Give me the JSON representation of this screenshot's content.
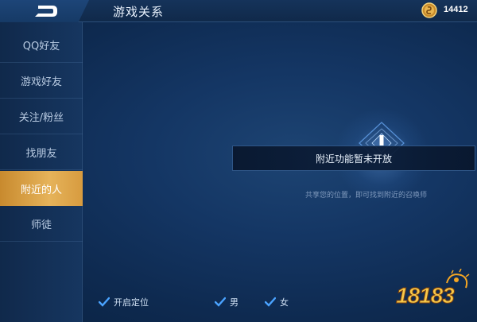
{
  "header": {
    "back_label": "返回",
    "title": "游戏关系",
    "coin_count": "14412"
  },
  "sidebar": {
    "items": [
      {
        "label": "QQ好友",
        "active": false
      },
      {
        "label": "游戏好友",
        "active": false
      },
      {
        "label": "关注/粉丝",
        "active": false
      },
      {
        "label": "找朋友",
        "active": false
      },
      {
        "label": "附近的人",
        "active": true
      },
      {
        "label": "师徒",
        "active": false
      }
    ]
  },
  "main": {
    "notice": "附近功能暂未开放",
    "hint": "共享您的位置，即可找到附近的召唤师"
  },
  "filters": {
    "location_label": "开启定位",
    "male_label": "男",
    "female_label": "女",
    "location_checked": true,
    "male_checked": true,
    "female_checked": true
  },
  "watermark": {
    "text": "18183"
  },
  "colors": {
    "accent_gold": "#e6b35a",
    "check_blue": "#4aa3ff",
    "background": "#143664"
  }
}
